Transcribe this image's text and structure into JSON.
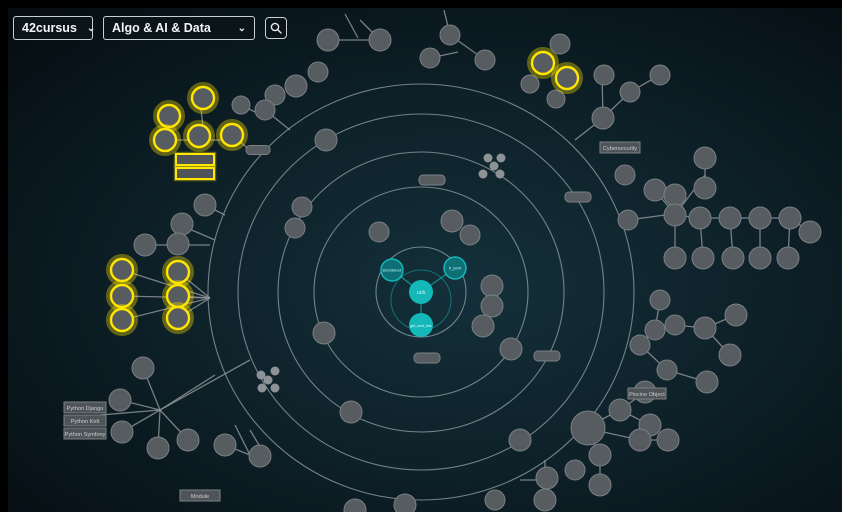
{
  "toolbar": {
    "cursus_select": {
      "value": "42cursus"
    },
    "branch_select": {
      "value": "Algo & AI & Data"
    },
    "search_icon": "magnifier"
  },
  "colors": {
    "background": "#0e2129",
    "ring": "#8a9ba2",
    "node_fill": "#575c60",
    "node_stroke": "#7a8085",
    "core_node": "#14b8b8",
    "highlight": "#ffe600",
    "link": "#8c9296"
  },
  "center": {
    "core_node_label": "Libft",
    "second_core_label": "get_next_line",
    "satellites": [
      "ft_printf",
      "Born2beroot"
    ]
  },
  "labeled_boxes": [
    "Python Django",
    "Python Kelt",
    "Python Symfony",
    "Module",
    "Cybersecurity",
    "Piscine Object"
  ]
}
